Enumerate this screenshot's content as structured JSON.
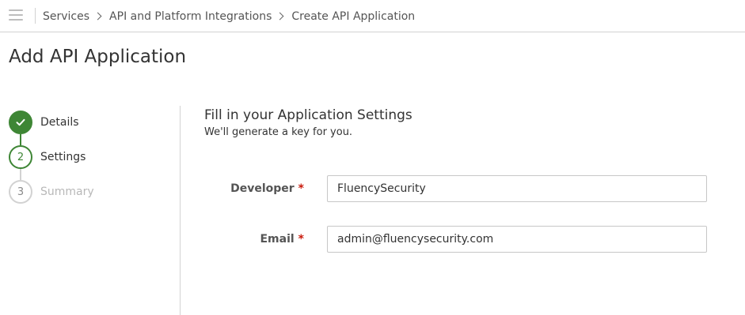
{
  "breadcrumb": {
    "items": [
      "Services",
      "API and Platform Integrations",
      "Create API Application"
    ]
  },
  "page": {
    "title": "Add API Application"
  },
  "wizard": {
    "steps": [
      {
        "number": "1",
        "label": "Details",
        "status": "done"
      },
      {
        "number": "2",
        "label": "Settings",
        "status": "active"
      },
      {
        "number": "3",
        "label": "Summary",
        "status": "todo"
      }
    ]
  },
  "form": {
    "heading": "Fill in your Application Settings",
    "subheading": "We'll generate a key for you.",
    "developer": {
      "label": "Developer",
      "required_mark": "*",
      "value": "FluencySecurity"
    },
    "email": {
      "label": "Email",
      "required_mark": "*",
      "value": "admin@fluencysecurity.com"
    }
  },
  "colors": {
    "accent_green": "#3e8635",
    "required_red": "#c9190b",
    "border_grey": "#d2d2d2"
  },
  "icons": {
    "menu": "hamburger-menu-icon",
    "separator": "chevron-right-icon",
    "step_done": "check-icon"
  }
}
